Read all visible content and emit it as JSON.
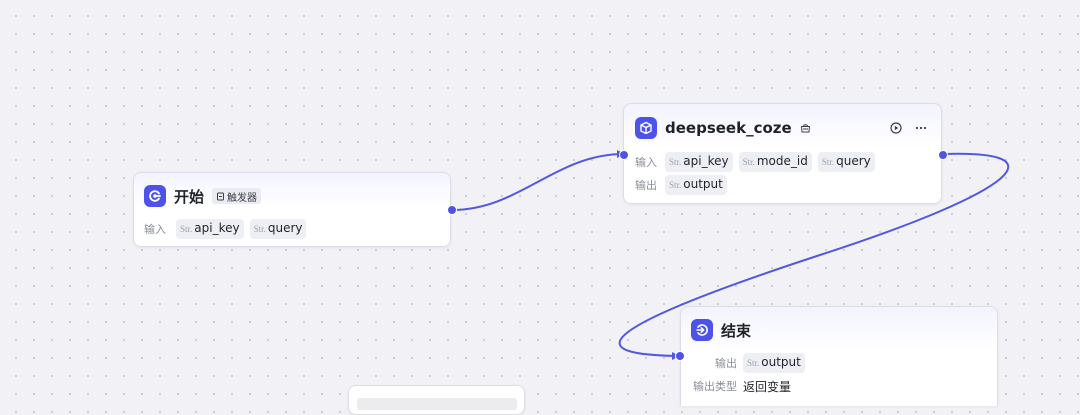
{
  "nodes": {
    "start": {
      "title": "开始",
      "badge": "触发器",
      "input_label": "输入",
      "inputs": [
        {
          "type": "Str.",
          "name": "api_key"
        },
        {
          "type": "Str.",
          "name": "query"
        }
      ]
    },
    "plugin": {
      "title": "deepseek_coze",
      "input_label": "输入",
      "inputs": [
        {
          "type": "Str.",
          "name": "api_key"
        },
        {
          "type": "Str.",
          "name": "mode_id"
        },
        {
          "type": "Str.",
          "name": "query"
        }
      ],
      "output_label": "输出",
      "outputs": [
        {
          "type": "Str.",
          "name": "output"
        }
      ]
    },
    "end": {
      "title": "结束",
      "output_label": "输出",
      "outputs": [
        {
          "type": "Str.",
          "name": "output"
        }
      ],
      "output_type_label": "输出类型",
      "output_type_value": "返回变量"
    }
  },
  "colors": {
    "accent": "#4d53e8",
    "edge": "#5358e0",
    "canvas": "#f2f2f6",
    "node_border": "#dcdde6"
  },
  "icons": {
    "start": "start-node-icon",
    "plugin": "plugin-cube-icon",
    "plugin_title_suffix": "plugin-store-icon",
    "end": "end-node-icon",
    "run": "play-icon",
    "more": "more-icon",
    "trigger": "trigger-icon"
  }
}
